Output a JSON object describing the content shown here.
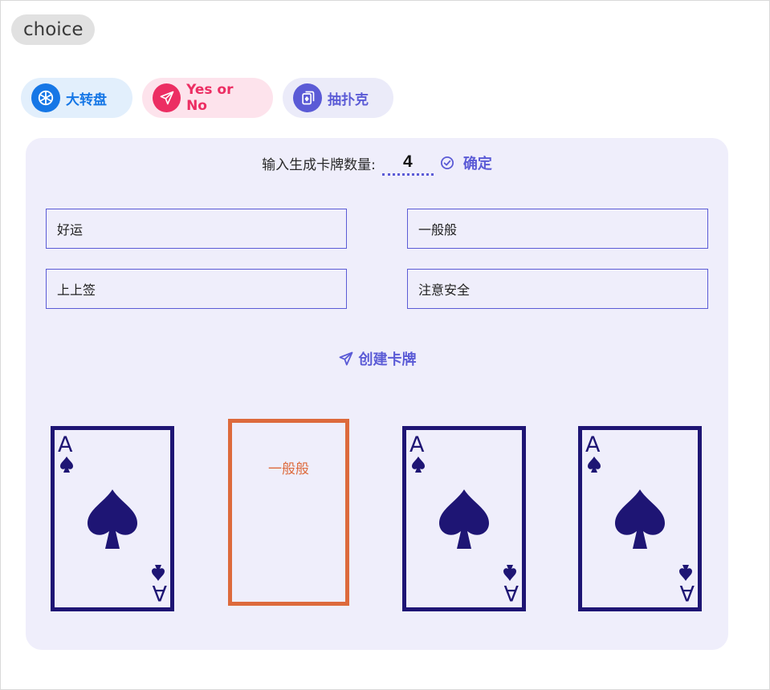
{
  "app": {
    "title": "choice"
  },
  "tabs": [
    {
      "label": "大转盘",
      "icon": "snowflake-icon",
      "color": "#1677e6"
    },
    {
      "label": "Yes or No",
      "icon": "send-icon",
      "color": "#ec2e63"
    },
    {
      "label": "抽扑克",
      "icon": "poker-card-icon",
      "color": "#5b5bd6"
    }
  ],
  "count": {
    "label": "输入生成卡牌数量:",
    "value": "4",
    "confirm_label": "确定"
  },
  "fields": [
    "好运",
    "一般般",
    "上上签",
    "注意安全"
  ],
  "create_label": "创建卡牌",
  "cards": [
    {
      "state": "back",
      "rank": "A",
      "suit": "spade"
    },
    {
      "state": "revealed",
      "text": "一般般"
    },
    {
      "state": "back",
      "rank": "A",
      "suit": "spade"
    },
    {
      "state": "back",
      "rank": "A",
      "suit": "spade"
    }
  ],
  "colors": {
    "accent": "#5b5bd6",
    "card_ink": "#1e1574",
    "revealed": "#dd6a3c",
    "panel_bg": "#efeefb"
  }
}
